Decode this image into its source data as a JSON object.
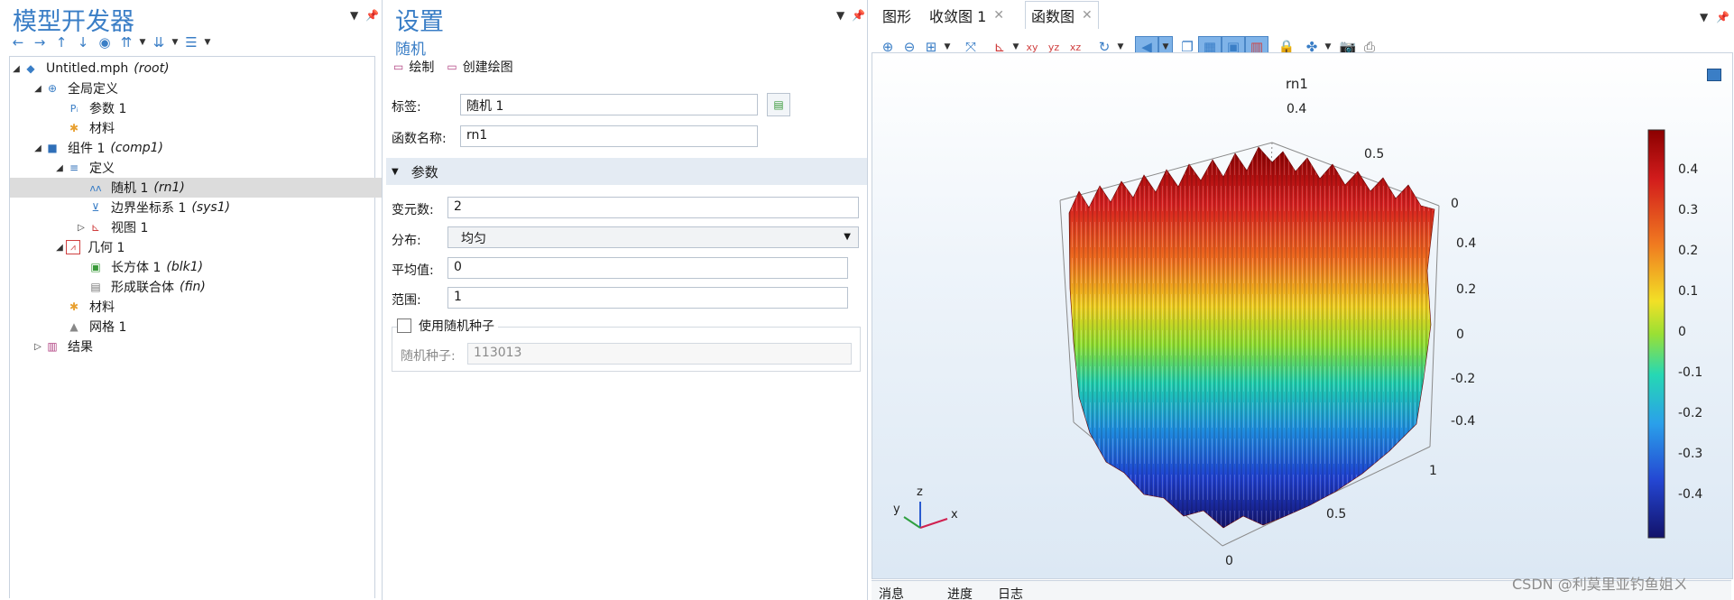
{
  "left": {
    "title": "模型开发器",
    "tree": [
      {
        "label": "Untitled.mph",
        "tag": "(root)"
      },
      {
        "label": "全局定义",
        "tag": ""
      },
      {
        "label": "参数 1",
        "tag": ""
      },
      {
        "label": "材料",
        "tag": ""
      },
      {
        "label": "组件 1",
        "tag": "(comp1)"
      },
      {
        "label": "定义",
        "tag": ""
      },
      {
        "label": "随机 1",
        "tag": "(rn1)"
      },
      {
        "label": "边界坐标系 1",
        "tag": "(sys1)"
      },
      {
        "label": "视图 1",
        "tag": ""
      },
      {
        "label": "几何 1",
        "tag": ""
      },
      {
        "label": "长方体 1",
        "tag": "(blk1)"
      },
      {
        "label": "形成联合体",
        "tag": "(fin)"
      },
      {
        "label": "材料",
        "tag": ""
      },
      {
        "label": "网格 1",
        "tag": ""
      },
      {
        "label": "结果",
        "tag": ""
      }
    ]
  },
  "settings": {
    "title": "设置",
    "subtitle": "随机",
    "plot_btn": "绘制",
    "create_plot_btn": "创建绘图",
    "label_caption": "标签:",
    "label_value": "随机 1",
    "fname_caption": "函数名称:",
    "fname_value": "rn1",
    "section": "参数",
    "nargs_caption": "变元数:",
    "nargs_value": "2",
    "dist_caption": "分布:",
    "dist_value": "均匀",
    "mean_caption": "平均值:",
    "mean_value": "0",
    "range_caption": "范围:",
    "range_value": "1",
    "seed_check": "使用随机种子",
    "seed_caption": "随机种子:",
    "seed_value": "113013"
  },
  "graphics": {
    "tabs": [
      "图形",
      "收敛图 1",
      "函数图"
    ],
    "plot_title": "rn1",
    "x_ticks": [
      "0",
      "0.5",
      "1"
    ],
    "y_ticks": [
      "0",
      "0.5",
      "1"
    ],
    "z_ticks": [
      "-0.4",
      "-0.2",
      "0",
      "0.2",
      "0.4"
    ],
    "triad": {
      "x": "x",
      "y": "y",
      "z": "z"
    },
    "colorbar_ticks": [
      "0.4",
      "0.3",
      "0.2",
      "0.1",
      "0",
      "-0.1",
      "-0.2",
      "-0.3",
      "-0.4"
    ],
    "bottom_tabs": [
      "消息",
      "进度",
      "日志"
    ],
    "watermark": "CSDN @利莫里亚钓鱼姐ㄨ"
  }
}
